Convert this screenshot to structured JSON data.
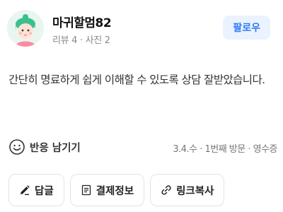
{
  "user": {
    "name": "마귀할멈82",
    "meta": "리뷰 4 · 사진 2",
    "follow_label": "팔로우"
  },
  "review": {
    "text": "간단히 명료하게 쉽게 이해할 수 있도록 상담 잘받았습니다."
  },
  "reaction": {
    "label": "반응 남기기",
    "visit_info": "3.4.수 · 1번째 방문 · 영수증"
  },
  "actions": {
    "reply_label": "답글",
    "payment_label": "결제정보",
    "copylink_label": "링크복사"
  },
  "colors": {
    "accent": "#2f7cf6",
    "follow_bg": "#eaf3ff",
    "avatar_bg": "#e8f6ef"
  },
  "icons": [
    "avatar-character",
    "smile-icon",
    "pencil-icon",
    "receipt-icon",
    "link-icon"
  ]
}
